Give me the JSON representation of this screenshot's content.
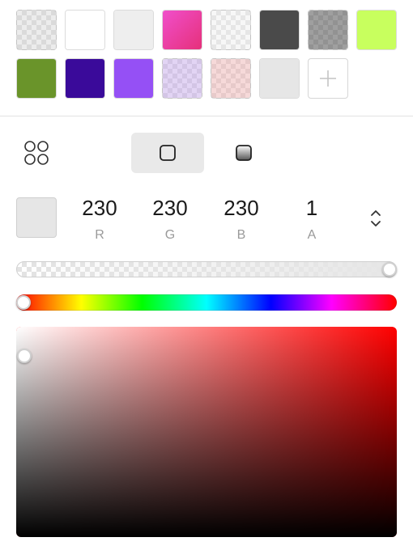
{
  "palette": [
    {
      "name": "transparent-gray",
      "color": "rgba(200,200,200,0.35)"
    },
    {
      "name": "white",
      "color": "#ffffff"
    },
    {
      "name": "light-gray",
      "color": "#eeeeee"
    },
    {
      "name": "pink",
      "color": "linear-gradient(135deg,#f04fcb,#e6307a)"
    },
    {
      "name": "transparent-light",
      "color": "rgba(235,235,235,0.4)"
    },
    {
      "name": "dark-gray",
      "color": "#4a4a4a"
    },
    {
      "name": "transparent-dark",
      "color": "rgba(80,80,80,0.55)"
    },
    {
      "name": "lime",
      "color": "#c8ff5e"
    },
    {
      "name": "olive-green",
      "color": "#6a942a"
    },
    {
      "name": "indigo",
      "color": "#3a0a9a"
    },
    {
      "name": "violet",
      "color": "#9550f5"
    },
    {
      "name": "transparent-lavender",
      "color": "rgba(190,160,230,0.45)"
    },
    {
      "name": "transparent-rose",
      "color": "rgba(235,170,170,0.45)"
    },
    {
      "name": "very-light-gray",
      "color": "#e6e6e6"
    }
  ],
  "current_color": {
    "hex": "#e6e6e6"
  },
  "channels": [
    {
      "value": "230",
      "label": "R"
    },
    {
      "value": "230",
      "label": "G"
    },
    {
      "value": "230",
      "label": "B"
    },
    {
      "value": "1",
      "label": "A"
    }
  ],
  "alpha": 1.0,
  "hue": 0.0,
  "saturation": 0.0,
  "brightness": 0.9,
  "hue_base_color": "#ff0000"
}
